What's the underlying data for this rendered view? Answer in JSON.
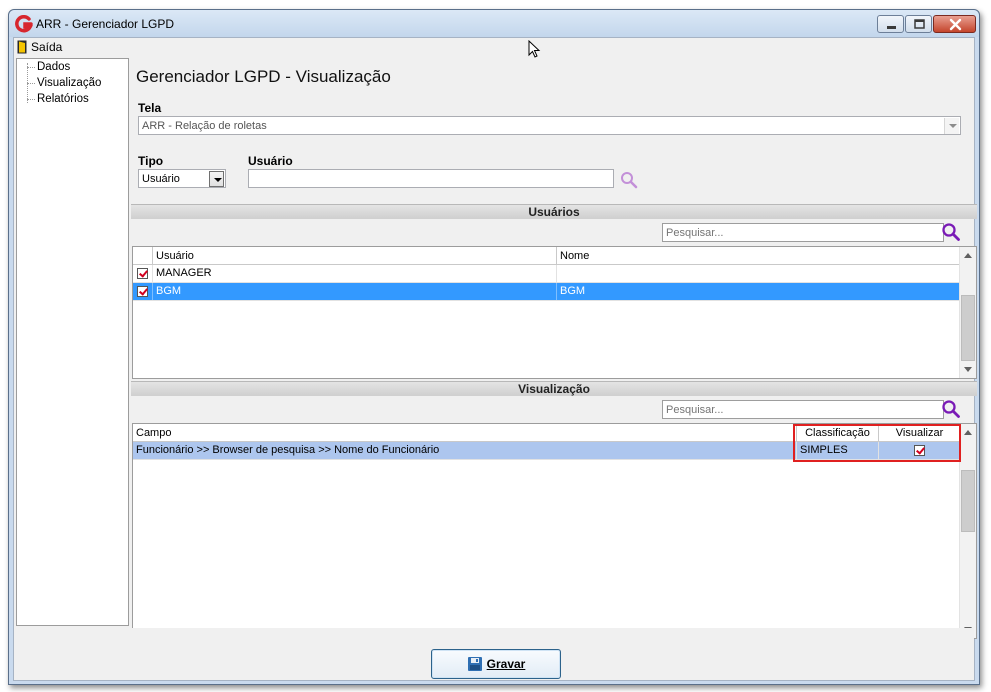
{
  "window": {
    "title": "ARR - Gerenciador LGPD"
  },
  "menu": {
    "exit_label": "Saída"
  },
  "nav": {
    "items": [
      {
        "label": "Dados"
      },
      {
        "label": "Visualização"
      },
      {
        "label": "Relatórios"
      }
    ]
  },
  "main": {
    "page_title": "Gerenciador LGPD - Visualização",
    "screen_label": "Tela",
    "screen_value": "ARR -  Relação de roletas",
    "type_label": "Tipo",
    "type_value": "Usuário",
    "user_label": "Usuário",
    "user_value": ""
  },
  "users_section": {
    "title": "Usuários",
    "search_placeholder": "Pesquisar...",
    "columns": [
      "Usuário",
      "Nome"
    ],
    "rows": [
      {
        "checked": true,
        "user": "MANAGER",
        "name": "",
        "selected": false
      },
      {
        "checked": true,
        "user": "BGM",
        "name": "BGM",
        "selected": true
      }
    ]
  },
  "view_section": {
    "title": "Visualização",
    "search_placeholder": "Pesquisar...",
    "columns": [
      "Campo",
      "Classificação",
      "Visualizar"
    ],
    "rows": [
      {
        "field": "Funcionário >> Browser de pesquisa >> Nome do Funcionário",
        "classification": "SIMPLES",
        "visible": true
      }
    ]
  },
  "footer": {
    "save_label": "Gravar"
  },
  "colors": {
    "selected_row": "#3399ff",
    "highlight_row": "#adc6ee",
    "frame": "#e02020",
    "check": "#d2001e"
  }
}
